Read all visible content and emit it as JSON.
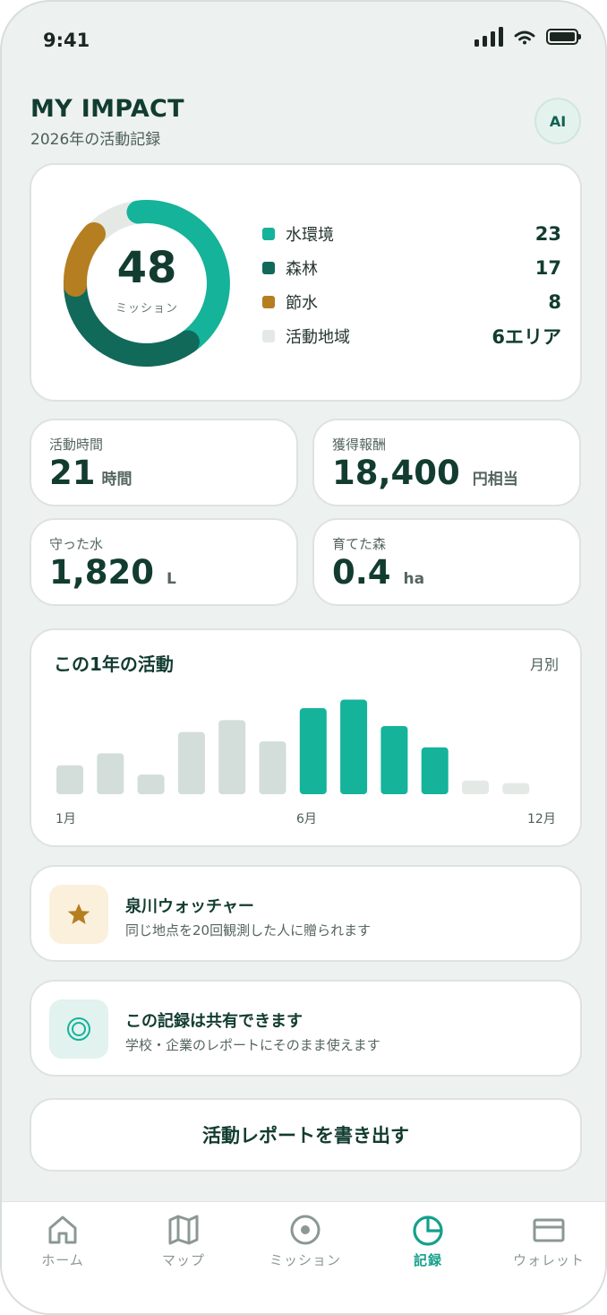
{
  "status_bar": {
    "time": "9:41"
  },
  "header": {
    "title": "MY IMPACT",
    "subtitle": "2026年の活動記録",
    "ai_label": "AI"
  },
  "summary": {
    "total": "48",
    "total_label": "ミッション",
    "legend": [
      {
        "label": "水環境",
        "value": "23",
        "color": "#14b39a"
      },
      {
        "label": "森林",
        "value": "17",
        "color": "#11695a"
      },
      {
        "label": "節水",
        "value": "8",
        "color": "#b57e21"
      },
      {
        "label": "活動地域",
        "value": "6エリア",
        "color": "#e4e9e6"
      }
    ]
  },
  "stats": [
    {
      "label": "活動時間",
      "value": "21",
      "unit": "時間"
    },
    {
      "label": "獲得報酬",
      "value": "18,400",
      "unit": "円相当"
    },
    {
      "label": "守った水",
      "value": "1,820",
      "unit": "L"
    },
    {
      "label": "育てた森",
      "value": "0.4",
      "unit": "ha"
    }
  ],
  "activity": {
    "title": "この1年の活動",
    "period": "月別",
    "axis_labels": {
      "start": "1月",
      "mid": "6月",
      "end": "12月"
    }
  },
  "chart_data": {
    "type": "bar",
    "categories": [
      "1月",
      "2月",
      "3月",
      "4月",
      "5月",
      "6月",
      "7月",
      "8月",
      "9月",
      "10月",
      "11月",
      "12月"
    ],
    "values": [
      3.4,
      4.8,
      2.3,
      7.3,
      8.7,
      6.2,
      10.1,
      11.1,
      8.0,
      5.5,
      1.6,
      1.3
    ],
    "highlighted": [
      false,
      false,
      false,
      false,
      false,
      false,
      true,
      true,
      true,
      true,
      false,
      false
    ],
    "colors": {
      "normal": "#d3dedb",
      "highlight": "#14b39a",
      "muted": "#e4e9e6"
    },
    "muted": [
      false,
      false,
      false,
      false,
      false,
      false,
      false,
      false,
      false,
      false,
      true,
      true
    ],
    "ylim": [
      0,
      12
    ]
  },
  "badge": {
    "title": "泉川ウォッチャー",
    "description": "同じ地点を20回観測した人に贈られます",
    "icon": "star-icon"
  },
  "share": {
    "title": "この記録は共有できます",
    "description": "学校・企業のレポートにそのまま使えます",
    "icon": "target-icon"
  },
  "export_label": "活動レポートを書き出す",
  "tabs": [
    {
      "label": "ホーム",
      "icon": "home-icon",
      "active": false
    },
    {
      "label": "マップ",
      "icon": "map-icon",
      "active": false
    },
    {
      "label": "ミッション",
      "icon": "mission-icon",
      "active": false
    },
    {
      "label": "記録",
      "icon": "chart-icon",
      "active": true
    },
    {
      "label": "ウォレット",
      "icon": "wallet-icon",
      "active": false
    }
  ]
}
